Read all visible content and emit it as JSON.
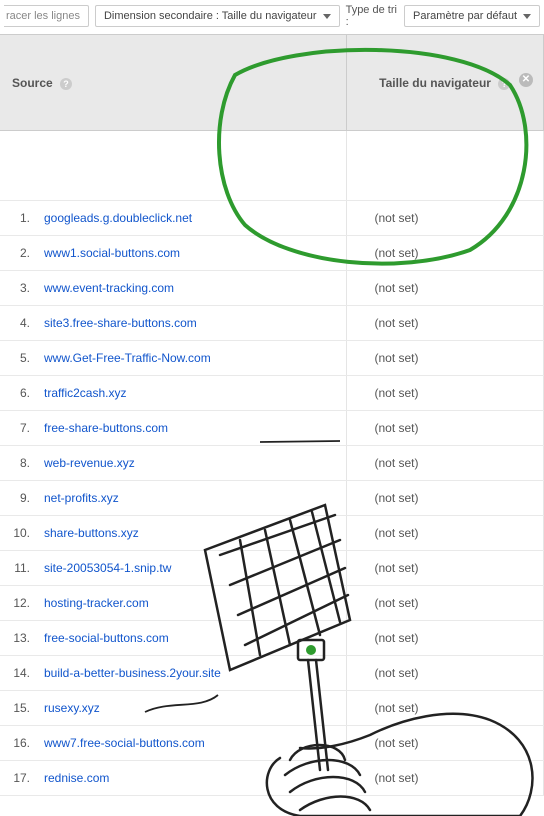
{
  "toolbar": {
    "trace_lines_partial": "racer les lignes",
    "secondary_dim_label": "Dimension secondaire : Taille du navigateur",
    "sort_type_label": "Type de tri :",
    "sort_default_label": "Paramètre par défaut"
  },
  "columns": {
    "source": "Source",
    "browser_size": "Taille du navigateur"
  },
  "help_glyph": "?",
  "close_glyph": "✕",
  "rows": [
    {
      "n": "1.",
      "source": "googleads.g.doubleclick.net",
      "size": "(not set)"
    },
    {
      "n": "2.",
      "source": "www1.social-buttons.com",
      "size": "(not set)"
    },
    {
      "n": "3.",
      "source": "www.event-tracking.com",
      "size": "(not set)"
    },
    {
      "n": "4.",
      "source": "site3.free-share-buttons.com",
      "size": "(not set)"
    },
    {
      "n": "5.",
      "source": "www.Get-Free-Traffic-Now.com",
      "size": "(not set)"
    },
    {
      "n": "6.",
      "source": "traffic2cash.xyz",
      "size": "(not set)"
    },
    {
      "n": "7.",
      "source": "free-share-buttons.com",
      "size": "(not set)"
    },
    {
      "n": "8.",
      "source": "web-revenue.xyz",
      "size": "(not set)"
    },
    {
      "n": "9.",
      "source": "net-profits.xyz",
      "size": "(not set)"
    },
    {
      "n": "10.",
      "source": "share-buttons.xyz",
      "size": "(not set)"
    },
    {
      "n": "11.",
      "source": "site-20053054-1.snip.tw",
      "size": "(not set)"
    },
    {
      "n": "12.",
      "source": "hosting-tracker.com",
      "size": "(not set)"
    },
    {
      "n": "13.",
      "source": "free-social-buttons.com",
      "size": "(not set)"
    },
    {
      "n": "14.",
      "source": "build-a-better-business.2your.site",
      "size": "(not set)"
    },
    {
      "n": "15.",
      "source": "rusexy.xyz",
      "size": "(not set)"
    },
    {
      "n": "16.",
      "source": "www7.free-social-buttons.com",
      "size": "(not set)"
    },
    {
      "n": "17.",
      "source": "rednise.com",
      "size": "(not set)"
    }
  ]
}
